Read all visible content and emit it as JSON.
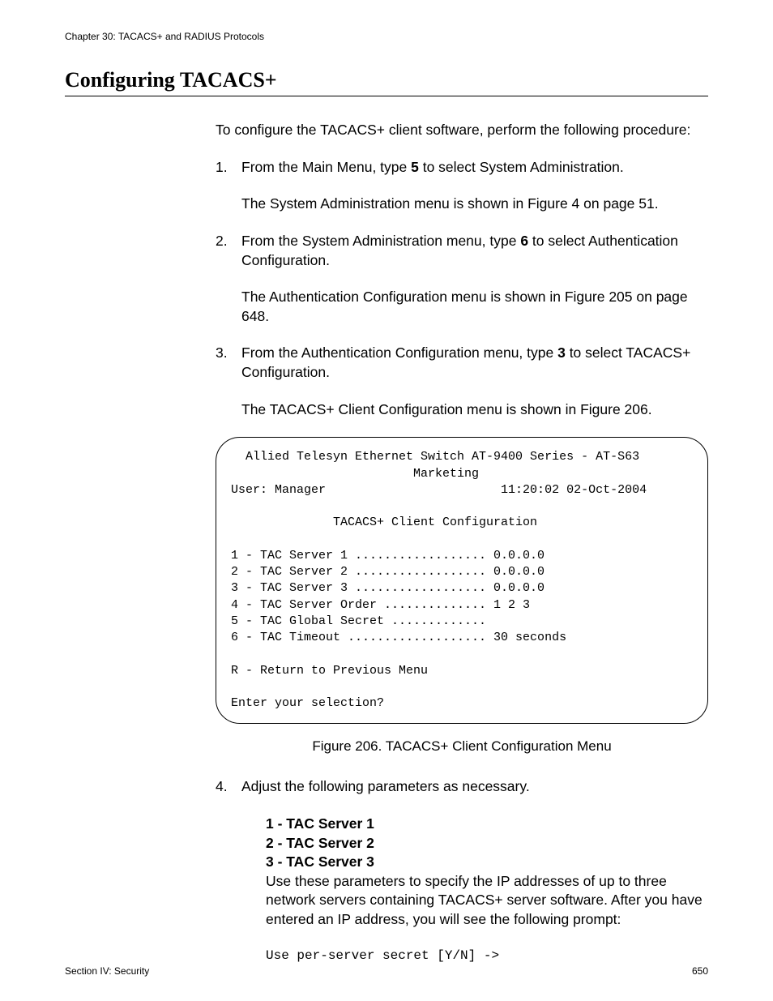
{
  "chapter_header": "Chapter 30: TACACS+ and RADIUS Protocols",
  "section_title": "Configuring TACACS+",
  "intro": "To configure the TACACS+ client software, perform the following procedure:",
  "step1": {
    "num": "1.",
    "pre": "From the Main Menu, type ",
    "bold": "5",
    "post": " to select System Administration.",
    "sub": "The System Administration menu is shown in Figure 4 on page 51."
  },
  "step2": {
    "num": "2.",
    "pre": "From the System Administration menu, type ",
    "bold": "6",
    "post": " to select Authentication Configuration.",
    "sub": "The Authentication Configuration menu is shown in Figure 205 on page 648."
  },
  "step3": {
    "num": "3.",
    "pre": "From the Authentication Configuration menu, type ",
    "bold": "3",
    "post": " to select TACACS+ Configuration.",
    "sub": "The TACACS+ Client Configuration menu is shown in Figure 206."
  },
  "terminal": {
    "line1": "  Allied Telesyn Ethernet Switch AT-9400 Series - AT-S63",
    "line2": "                         Marketing",
    "line3": "User: Manager                        11:20:02 02-Oct-2004",
    "line4": "",
    "line5": "              TACACS+ Client Configuration",
    "line6": "",
    "line7": "1 - TAC Server 1 .................. 0.0.0.0",
    "line8": "2 - TAC Server 2 .................. 0.0.0.0",
    "line9": "3 - TAC Server 3 .................. 0.0.0.0",
    "line10": "4 - TAC Server Order .............. 1 2 3",
    "line11": "5 - TAC Global Secret .............",
    "line12": "6 - TAC Timeout ................... 30 seconds",
    "line13": "",
    "line14": "R - Return to Previous Menu",
    "line15": "",
    "line16": "Enter your selection?"
  },
  "figure_caption": "Figure 206.  TACACS+ Client Configuration Menu",
  "step4": {
    "num": "4.",
    "text": "Adjust the following parameters as necessary.",
    "param1": "1 - TAC Server 1",
    "param2": "2 - TAC Server 2",
    "param3": "3 - TAC Server 3",
    "param_desc": "Use these parameters to specify the IP addresses of up to three network servers containing TACACS+ server software. After you have entered an IP address, you will see the following prompt:",
    "prompt": "Use per-server secret [Y/N] ->"
  },
  "footer_left": "Section IV: Security",
  "footer_right": "650"
}
